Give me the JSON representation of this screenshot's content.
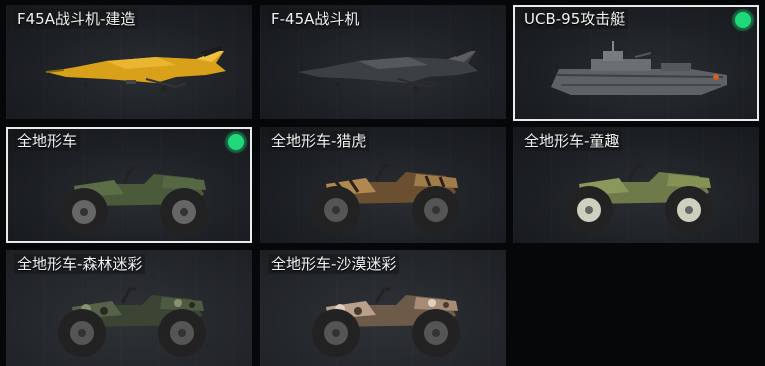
{
  "vehicles": [
    {
      "name": "F45A战斗机-建造",
      "type": "jet",
      "skin": "gold",
      "equipped": false,
      "selected": false
    },
    {
      "name": "F-45A战斗机",
      "type": "jet",
      "skin": "gray",
      "equipped": false,
      "selected": false
    },
    {
      "name": "UCB-95攻击艇",
      "type": "boat",
      "skin": "gray",
      "equipped": true,
      "selected": true
    },
    {
      "name": "全地形车",
      "type": "atv",
      "skin": "green",
      "equipped": true,
      "selected": true
    },
    {
      "name": "全地形车-猎虎",
      "type": "atv",
      "skin": "tiger",
      "equipped": false,
      "selected": false
    },
    {
      "name": "全地形车-童趣",
      "type": "atv",
      "skin": "olive",
      "equipped": false,
      "selected": false
    },
    {
      "name": "全地形车-森林迷彩",
      "type": "atv",
      "skin": "forest",
      "equipped": false,
      "selected": false
    },
    {
      "name": "全地形车-沙漠迷彩",
      "type": "atv",
      "skin": "desert",
      "equipped": false,
      "selected": false
    }
  ],
  "colors": {
    "equipped_indicator": "#1fd87a",
    "selected_border": "#e8eaeb",
    "background": "#060708"
  }
}
